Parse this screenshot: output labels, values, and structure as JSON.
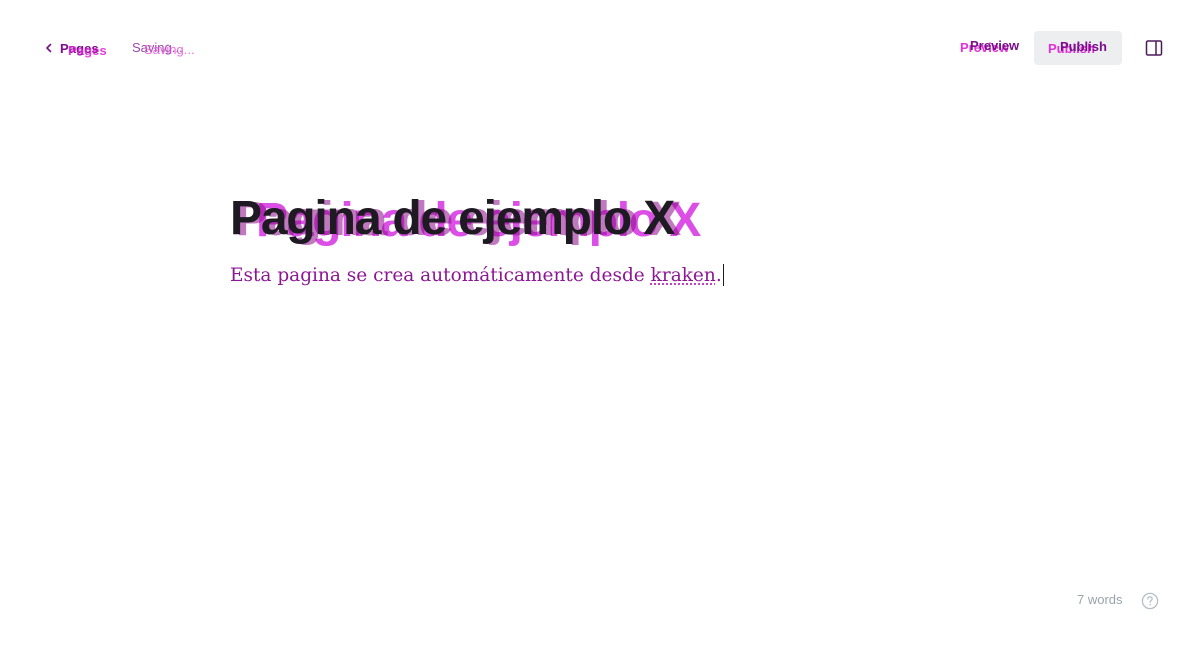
{
  "header": {
    "back_label": "Pages",
    "status_text": "Saving...",
    "preview_label": "Preview",
    "publish_label": "Publish"
  },
  "editor": {
    "title": "Pagina de ejemplo X",
    "body_prefix": "Esta pagina se crea automáticamente desde ",
    "body_underlined": "kraken",
    "body_suffix": "."
  },
  "footer": {
    "word_count": "7 words"
  },
  "icons": {
    "back": "chevron-left-icon",
    "sidebar": "sidebar-toggle-icon",
    "help": "help-icon"
  },
  "colors": {
    "accent": "#7a0f8a",
    "ghost": "#e11cd7",
    "publish_bg": "#eceef0",
    "muted": "#99a3ad"
  }
}
